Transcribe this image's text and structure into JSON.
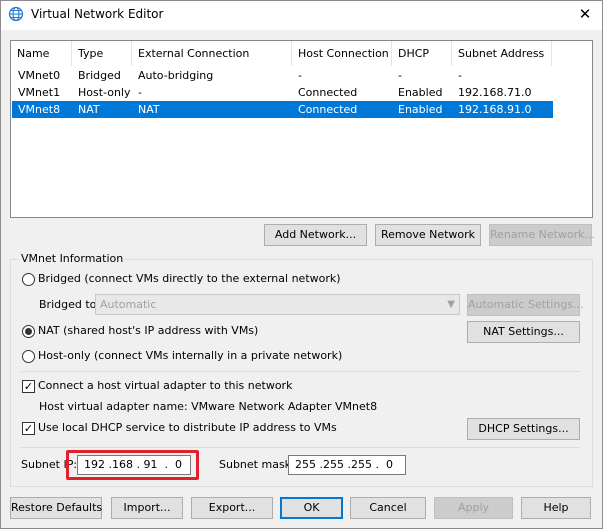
{
  "window": {
    "title": "Virtual Network Editor",
    "close_glyph": "✕"
  },
  "table": {
    "columns": [
      "Name",
      "Type",
      "External Connection",
      "Host Connection",
      "DHCP",
      "Subnet Address"
    ],
    "rows": [
      {
        "name": "VMnet0",
        "type": "Bridged",
        "external": "Auto-bridging",
        "host": "-",
        "dhcp": "-",
        "subnet": "-"
      },
      {
        "name": "VMnet1",
        "type": "Host-only",
        "external": "-",
        "host": "Connected",
        "dhcp": "Enabled",
        "subnet": "192.168.71.0"
      },
      {
        "name": "VMnet8",
        "type": "NAT",
        "external": "NAT",
        "host": "Connected",
        "dhcp": "Enabled",
        "subnet": "192.168.91.0"
      }
    ],
    "selected_row": 2
  },
  "network_buttons": {
    "add": "Add Network...",
    "remove": "Remove Network",
    "rename": "Rename Network..."
  },
  "vmnet_info": {
    "group_label": "VMnet Information",
    "bridged_label": "Bridged (connect VMs directly to the external network)",
    "bridged_to_label": "Bridged to:",
    "bridged_to_value": "Automatic",
    "automatic_settings": "Automatic Settings...",
    "nat_label": "NAT (shared host's IP address with VMs)",
    "nat_settings": "NAT Settings...",
    "hostonly_label": "Host-only (connect VMs internally in a private network)",
    "connect_adapter_label": "Connect a host virtual adapter to this network",
    "adapter_name_label": "Host virtual adapter name: VMware Network Adapter VMnet8",
    "dhcp_label": "Use local DHCP service to distribute IP address to VMs",
    "dhcp_settings": "DHCP Settings...",
    "selected_mode": "NAT",
    "connect_adapter_checked": true,
    "dhcp_checked": true
  },
  "subnet": {
    "ip_label": "Subnet IP:",
    "ip_value": "192 .168 . 91  .  0",
    "mask_label": "Subnet mask:",
    "mask_value": "255 .255 .255 .  0"
  },
  "footer_buttons": {
    "restore": "Restore Defaults",
    "import": "Import...",
    "export": "Export...",
    "ok": "OK",
    "cancel": "Cancel",
    "apply": "Apply",
    "help": "Help"
  },
  "colors": {
    "selection": "#0078d7",
    "highlight_box": "#e0212b",
    "default_button_border": "#0078d7"
  }
}
